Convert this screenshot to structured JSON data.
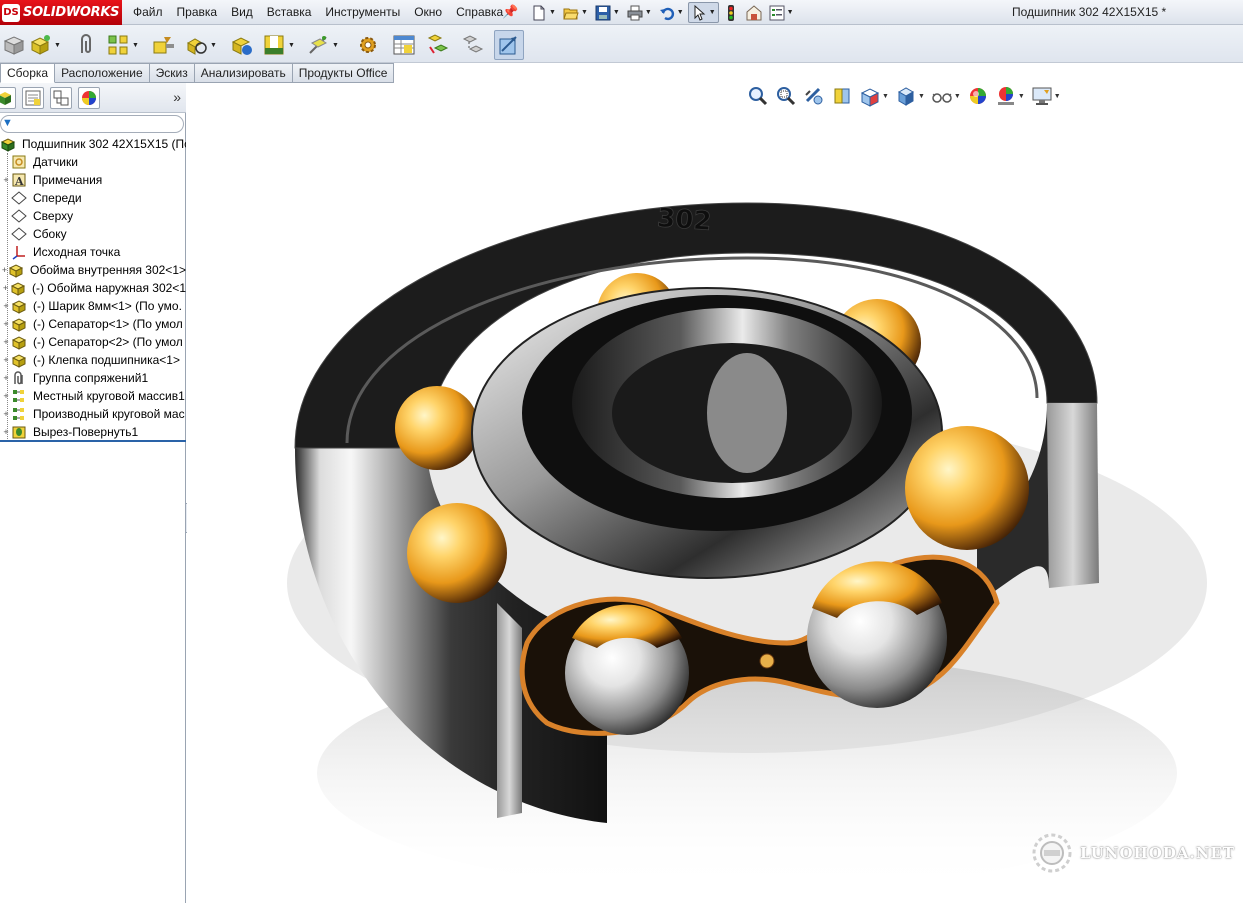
{
  "app": {
    "logo_text": "SOLIDWORKS",
    "logo_mark": "DS",
    "document_title": "Подшипник 302 42X15X15 *"
  },
  "menu": [
    "Файл",
    "Правка",
    "Вид",
    "Вставка",
    "Инструменты",
    "Окно",
    "Справка"
  ],
  "quick_toolbar": [
    {
      "icon": "new-document-icon"
    },
    {
      "icon": "open-folder-icon"
    },
    {
      "icon": "save-icon"
    },
    {
      "icon": "print-icon"
    },
    {
      "icon": "undo-icon"
    },
    {
      "icon": "select-pointer-icon",
      "pressed": true
    },
    {
      "icon": "rebuild-traffic-light-icon"
    },
    {
      "icon": "file-properties-icon"
    },
    {
      "icon": "options-icon"
    }
  ],
  "tabs": [
    {
      "label": "Сборка",
      "active": true
    },
    {
      "label": "Расположение",
      "active": false
    },
    {
      "label": "Эскиз",
      "active": false
    },
    {
      "label": "Анализировать",
      "active": false
    },
    {
      "label": "Продукты Office",
      "active": false
    }
  ],
  "feature_tree": {
    "root": "Подшипник 302 42X15X15  (По",
    "items": [
      {
        "label": "Датчики",
        "icon": "sensor-icon",
        "expandable": false
      },
      {
        "label": "Примечания",
        "icon": "annotations-icon",
        "expandable": true
      },
      {
        "label": "Спереди",
        "icon": "plane-icon",
        "expandable": false
      },
      {
        "label": "Сверху",
        "icon": "plane-icon",
        "expandable": false
      },
      {
        "label": "Сбоку",
        "icon": "plane-icon",
        "expandable": false
      },
      {
        "label": "Исходная точка",
        "icon": "origin-icon",
        "expandable": false
      },
      {
        "label": "Обойма внутренняя 302<1>",
        "icon": "part-icon",
        "expandable": true
      },
      {
        "label": "(-) Обойма наружная 302<1",
        "icon": "part-icon",
        "expandable": true
      },
      {
        "label": "(-) Шарик 8мм<1> (По умо.",
        "icon": "part-icon",
        "expandable": true
      },
      {
        "label": "(-) Сепаратор<1> (По умол",
        "icon": "part-icon",
        "expandable": true
      },
      {
        "label": "(-) Сепаратор<2> (По умол",
        "icon": "part-icon",
        "expandable": true
      },
      {
        "label": "(-) Клепка подшипника<1>",
        "icon": "part-icon",
        "expandable": true
      },
      {
        "label": "Группа сопряжений1",
        "icon": "mates-icon",
        "expandable": true
      },
      {
        "label": "Местный круговой массив1",
        "icon": "circular-pattern-icon",
        "expandable": true
      },
      {
        "label": "Производный круговой мас",
        "icon": "circular-pattern-icon",
        "expandable": true
      },
      {
        "label": "Вырез-Повернуть1",
        "icon": "revolve-cut-icon",
        "expandable": true
      }
    ]
  },
  "model": {
    "engraving": "302"
  },
  "watermark": {
    "text": "LUNOHODA.NET"
  },
  "colors": {
    "logo_red": "#d4101a",
    "tree_end_line": "#2a63a8",
    "ball_gold": "#f2a81e"
  }
}
